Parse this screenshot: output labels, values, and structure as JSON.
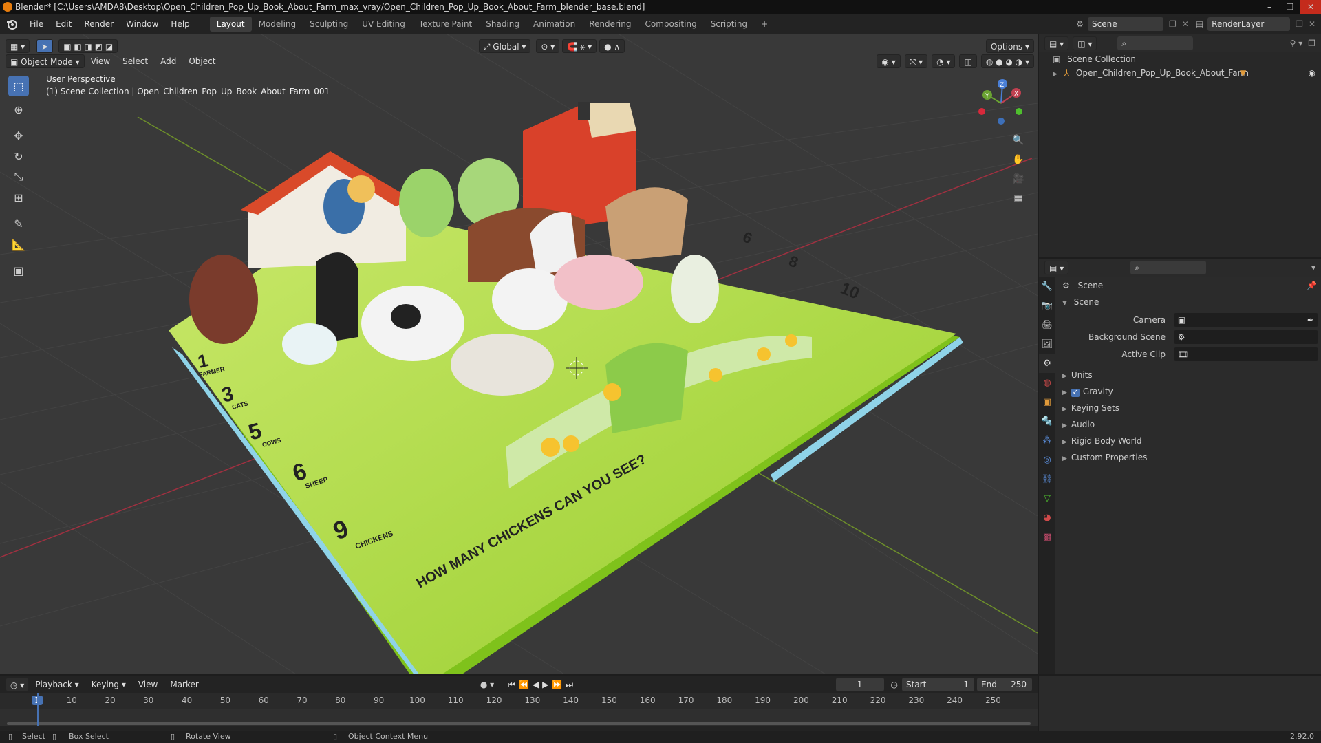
{
  "window": {
    "title": "Blender* [C:\\Users\\AMDA8\\Desktop\\Open_Children_Pop_Up_Book_About_Farm_max_vray/Open_Children_Pop_Up_Book_About_Farm_blender_base.blend]",
    "controls": [
      "–",
      "❐",
      "✕"
    ]
  },
  "menubar": {
    "items": [
      "File",
      "Edit",
      "Render",
      "Window",
      "Help"
    ]
  },
  "workspaces": [
    "Layout",
    "Modeling",
    "Sculpting",
    "UV Editing",
    "Texture Paint",
    "Shading",
    "Animation",
    "Rendering",
    "Compositing",
    "Scripting",
    "+"
  ],
  "topright": {
    "scene": "Scene",
    "renderlayer": "RenderLayer"
  },
  "viewport": {
    "mode": "Object Mode",
    "menus": [
      "View",
      "Select",
      "Add",
      "Object"
    ],
    "transform_orientation": "Global",
    "options": "Options",
    "overlay_title": "User Perspective",
    "overlay_subtitle": "(1) Scene Collection | Open_Children_Pop_Up_Book_About_Farm_001",
    "gizmo_axes": [
      "Z",
      "Y",
      "X"
    ],
    "book_page": {
      "heading": "HOW MANY CHICKENS CAN YOU SEE?",
      "counts": [
        {
          "n": "1",
          "label": "FARMER"
        },
        {
          "n": "3",
          "label": "CATS"
        },
        {
          "n": "5",
          "label": "COWS"
        },
        {
          "n": "6",
          "label": "SHEEP"
        },
        {
          "n": "9",
          "label": "CHICKENS"
        }
      ],
      "back_counts": [
        "6",
        "8",
        "10"
      ]
    }
  },
  "outliner": {
    "root": "Scene Collection",
    "items": [
      "Open_Children_Pop_Up_Book_About_Farm"
    ]
  },
  "properties": {
    "context_label": "Scene",
    "panel_title": "Scene",
    "fields": [
      {
        "label": "Camera",
        "value": ""
      },
      {
        "label": "Background Scene",
        "value": ""
      },
      {
        "label": "Active Clip",
        "value": ""
      }
    ],
    "subpanels": [
      "Units",
      "Gravity",
      "Keying Sets",
      "Audio",
      "Rigid Body World",
      "Custom Properties"
    ],
    "gravity_checked": true
  },
  "timeline": {
    "menus": [
      "Playback",
      "Keying",
      "View",
      "Marker"
    ],
    "current_frame": "1",
    "start_label": "Start",
    "start": "1",
    "end_label": "End",
    "end": "250",
    "ruler": [
      "1",
      "10",
      "20",
      "30",
      "40",
      "50",
      "60",
      "70",
      "80",
      "90",
      "100",
      "110",
      "120",
      "130",
      "140",
      "150",
      "160",
      "170",
      "180",
      "190",
      "200",
      "210",
      "220",
      "230",
      "240",
      "250"
    ]
  },
  "statusbar": {
    "items": [
      "Select",
      "Box Select",
      "Rotate View",
      "Object Context Menu"
    ],
    "version": "2.92.0"
  },
  "colors": {
    "accent": "#4772b3",
    "page_green": "#a6d63a",
    "page_edge": "#7fc21b",
    "book_blue": "#8fd3e8"
  }
}
